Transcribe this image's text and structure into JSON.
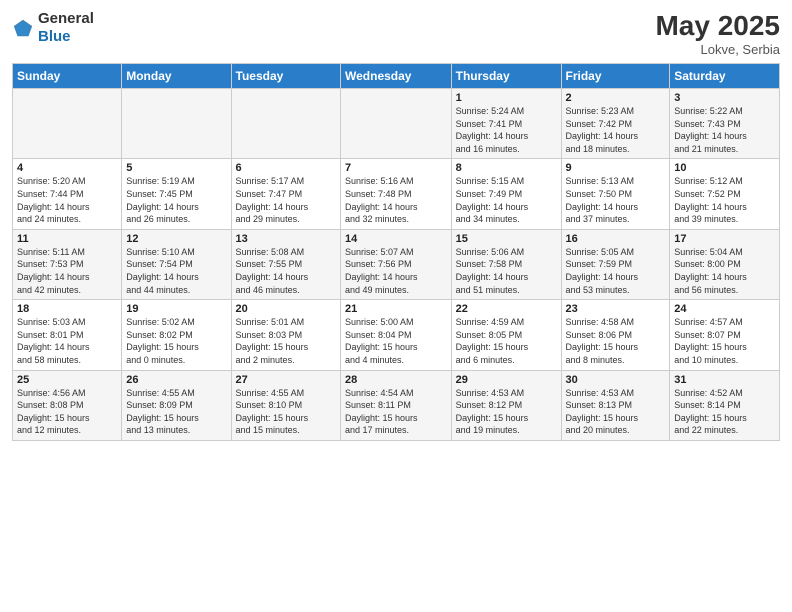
{
  "header": {
    "logo_general": "General",
    "logo_blue": "Blue",
    "title": "May 2025",
    "location": "Lokve, Serbia"
  },
  "weekdays": [
    "Sunday",
    "Monday",
    "Tuesday",
    "Wednesday",
    "Thursday",
    "Friday",
    "Saturday"
  ],
  "weeks": [
    [
      {
        "num": "",
        "info": ""
      },
      {
        "num": "",
        "info": ""
      },
      {
        "num": "",
        "info": ""
      },
      {
        "num": "",
        "info": ""
      },
      {
        "num": "1",
        "info": "Sunrise: 5:24 AM\nSunset: 7:41 PM\nDaylight: 14 hours\nand 16 minutes."
      },
      {
        "num": "2",
        "info": "Sunrise: 5:23 AM\nSunset: 7:42 PM\nDaylight: 14 hours\nand 18 minutes."
      },
      {
        "num": "3",
        "info": "Sunrise: 5:22 AM\nSunset: 7:43 PM\nDaylight: 14 hours\nand 21 minutes."
      }
    ],
    [
      {
        "num": "4",
        "info": "Sunrise: 5:20 AM\nSunset: 7:44 PM\nDaylight: 14 hours\nand 24 minutes."
      },
      {
        "num": "5",
        "info": "Sunrise: 5:19 AM\nSunset: 7:45 PM\nDaylight: 14 hours\nand 26 minutes."
      },
      {
        "num": "6",
        "info": "Sunrise: 5:17 AM\nSunset: 7:47 PM\nDaylight: 14 hours\nand 29 minutes."
      },
      {
        "num": "7",
        "info": "Sunrise: 5:16 AM\nSunset: 7:48 PM\nDaylight: 14 hours\nand 32 minutes."
      },
      {
        "num": "8",
        "info": "Sunrise: 5:15 AM\nSunset: 7:49 PM\nDaylight: 14 hours\nand 34 minutes."
      },
      {
        "num": "9",
        "info": "Sunrise: 5:13 AM\nSunset: 7:50 PM\nDaylight: 14 hours\nand 37 minutes."
      },
      {
        "num": "10",
        "info": "Sunrise: 5:12 AM\nSunset: 7:52 PM\nDaylight: 14 hours\nand 39 minutes."
      }
    ],
    [
      {
        "num": "11",
        "info": "Sunrise: 5:11 AM\nSunset: 7:53 PM\nDaylight: 14 hours\nand 42 minutes."
      },
      {
        "num": "12",
        "info": "Sunrise: 5:10 AM\nSunset: 7:54 PM\nDaylight: 14 hours\nand 44 minutes."
      },
      {
        "num": "13",
        "info": "Sunrise: 5:08 AM\nSunset: 7:55 PM\nDaylight: 14 hours\nand 46 minutes."
      },
      {
        "num": "14",
        "info": "Sunrise: 5:07 AM\nSunset: 7:56 PM\nDaylight: 14 hours\nand 49 minutes."
      },
      {
        "num": "15",
        "info": "Sunrise: 5:06 AM\nSunset: 7:58 PM\nDaylight: 14 hours\nand 51 minutes."
      },
      {
        "num": "16",
        "info": "Sunrise: 5:05 AM\nSunset: 7:59 PM\nDaylight: 14 hours\nand 53 minutes."
      },
      {
        "num": "17",
        "info": "Sunrise: 5:04 AM\nSunset: 8:00 PM\nDaylight: 14 hours\nand 56 minutes."
      }
    ],
    [
      {
        "num": "18",
        "info": "Sunrise: 5:03 AM\nSunset: 8:01 PM\nDaylight: 14 hours\nand 58 minutes."
      },
      {
        "num": "19",
        "info": "Sunrise: 5:02 AM\nSunset: 8:02 PM\nDaylight: 15 hours\nand 0 minutes."
      },
      {
        "num": "20",
        "info": "Sunrise: 5:01 AM\nSunset: 8:03 PM\nDaylight: 15 hours\nand 2 minutes."
      },
      {
        "num": "21",
        "info": "Sunrise: 5:00 AM\nSunset: 8:04 PM\nDaylight: 15 hours\nand 4 minutes."
      },
      {
        "num": "22",
        "info": "Sunrise: 4:59 AM\nSunset: 8:05 PM\nDaylight: 15 hours\nand 6 minutes."
      },
      {
        "num": "23",
        "info": "Sunrise: 4:58 AM\nSunset: 8:06 PM\nDaylight: 15 hours\nand 8 minutes."
      },
      {
        "num": "24",
        "info": "Sunrise: 4:57 AM\nSunset: 8:07 PM\nDaylight: 15 hours\nand 10 minutes."
      }
    ],
    [
      {
        "num": "25",
        "info": "Sunrise: 4:56 AM\nSunset: 8:08 PM\nDaylight: 15 hours\nand 12 minutes."
      },
      {
        "num": "26",
        "info": "Sunrise: 4:55 AM\nSunset: 8:09 PM\nDaylight: 15 hours\nand 13 minutes."
      },
      {
        "num": "27",
        "info": "Sunrise: 4:55 AM\nSunset: 8:10 PM\nDaylight: 15 hours\nand 15 minutes."
      },
      {
        "num": "28",
        "info": "Sunrise: 4:54 AM\nSunset: 8:11 PM\nDaylight: 15 hours\nand 17 minutes."
      },
      {
        "num": "29",
        "info": "Sunrise: 4:53 AM\nSunset: 8:12 PM\nDaylight: 15 hours\nand 19 minutes."
      },
      {
        "num": "30",
        "info": "Sunrise: 4:53 AM\nSunset: 8:13 PM\nDaylight: 15 hours\nand 20 minutes."
      },
      {
        "num": "31",
        "info": "Sunrise: 4:52 AM\nSunset: 8:14 PM\nDaylight: 15 hours\nand 22 minutes."
      }
    ]
  ]
}
